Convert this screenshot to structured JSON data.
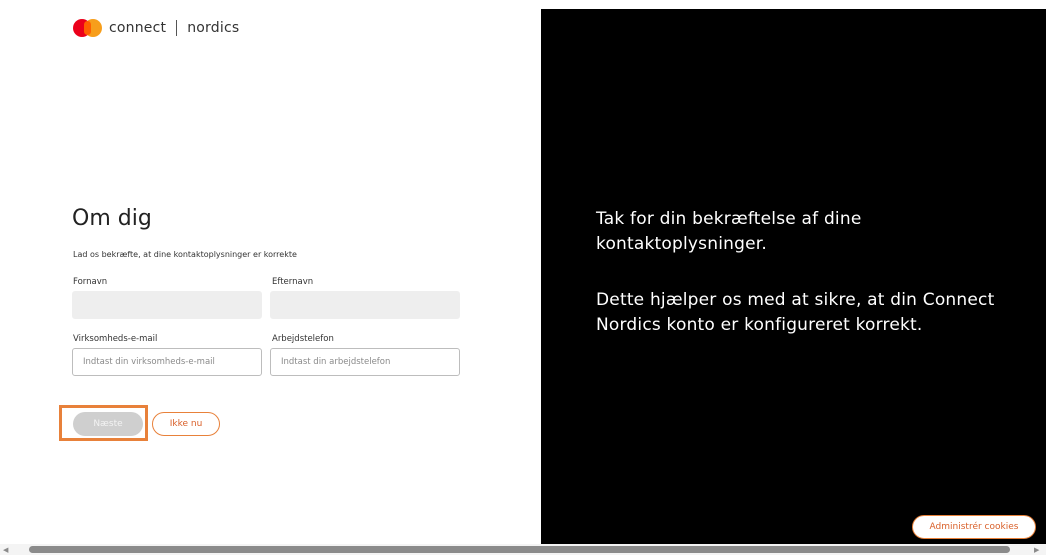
{
  "logo": {
    "brand": "connect",
    "product": "nordics"
  },
  "form": {
    "title": "Om dig",
    "subtitle": "Lad os bekræfte, at dine kontaktoplysninger er korrekte",
    "first_name": {
      "label": "Fornavn",
      "value": ""
    },
    "last_name": {
      "label": "Efternavn",
      "value": ""
    },
    "email": {
      "label": "Virksomheds-e-mail",
      "placeholder": "Indtast din virksomheds-e-mail"
    },
    "phone": {
      "label": "Arbejdstelefon",
      "placeholder": "Indtast din arbejdstelefon"
    },
    "next_label": "Næste",
    "skip_label": "Ikke nu"
  },
  "info": {
    "paragraph1": "Tak for din bekræftelse af dine kontaktoplysninger.",
    "paragraph2": "Dette hjælper os med at sikre, at din Connect Nordics konto er konfigureret korrekt."
  },
  "cookies_label": "Administrér cookies",
  "colors": {
    "accent": "#e8813a",
    "panel": "#000000",
    "disabled": "#cfcfcf"
  }
}
